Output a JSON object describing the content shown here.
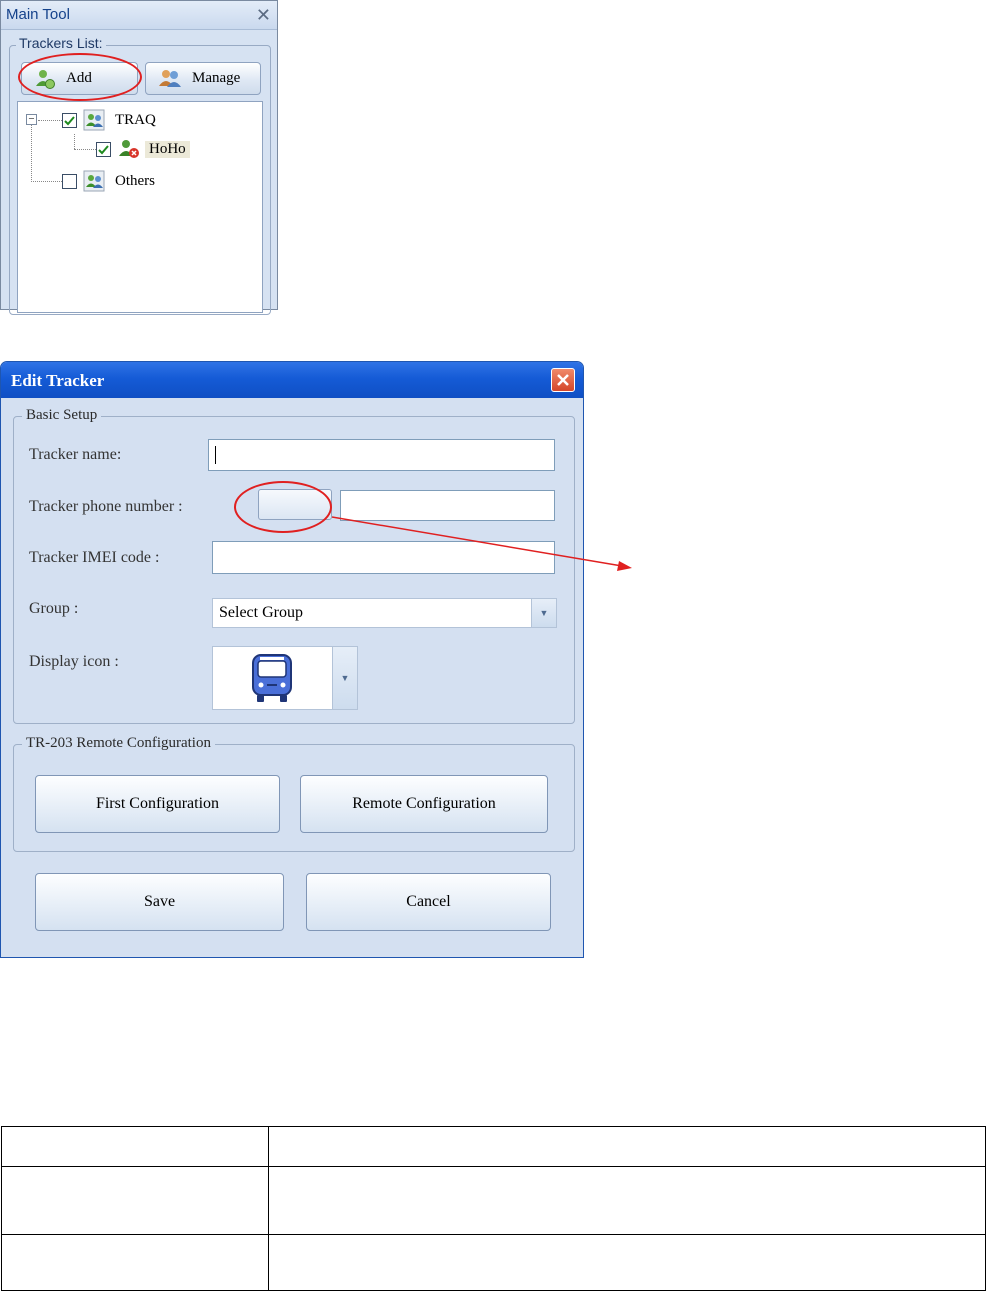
{
  "main_tool": {
    "title": "Main Tool",
    "close_glyph": "✕",
    "group_label": "Trackers List:",
    "add_button": "Add",
    "manage_button": "Manage",
    "tree": [
      {
        "label": "TRAQ",
        "checked": true,
        "expanded": true
      },
      {
        "label": "HoHo",
        "checked": true,
        "selected": true
      },
      {
        "label": "Others",
        "checked": false
      }
    ]
  },
  "dialog": {
    "title": "Edit Tracker",
    "basic_setup": {
      "legend": "Basic Setup",
      "tracker_name_label": "Tracker  name:",
      "tracker_name_value": "",
      "phone_label": "Tracker phone number :",
      "phone_value": "",
      "imei_label": "Tracker IMEI code :",
      "imei_value": "",
      "group_label": "Group :",
      "group_selected": "Select Group",
      "display_icon_label": "Display icon :",
      "display_icon": "bus-icon"
    },
    "remote": {
      "legend": "TR-203 Remote Configuration",
      "first_button": "First Configuration",
      "remote_button": "Remote Configuration"
    },
    "save_button": "Save",
    "cancel_button": "Cancel"
  },
  "colors": {
    "annotation_red": "#e02020",
    "titlebar_blue": "#155bd6",
    "dialog_bg": "#d4e0f1"
  },
  "table": {
    "rows": [
      [
        "",
        ""
      ],
      [
        "",
        ""
      ],
      [
        "",
        ""
      ]
    ]
  }
}
